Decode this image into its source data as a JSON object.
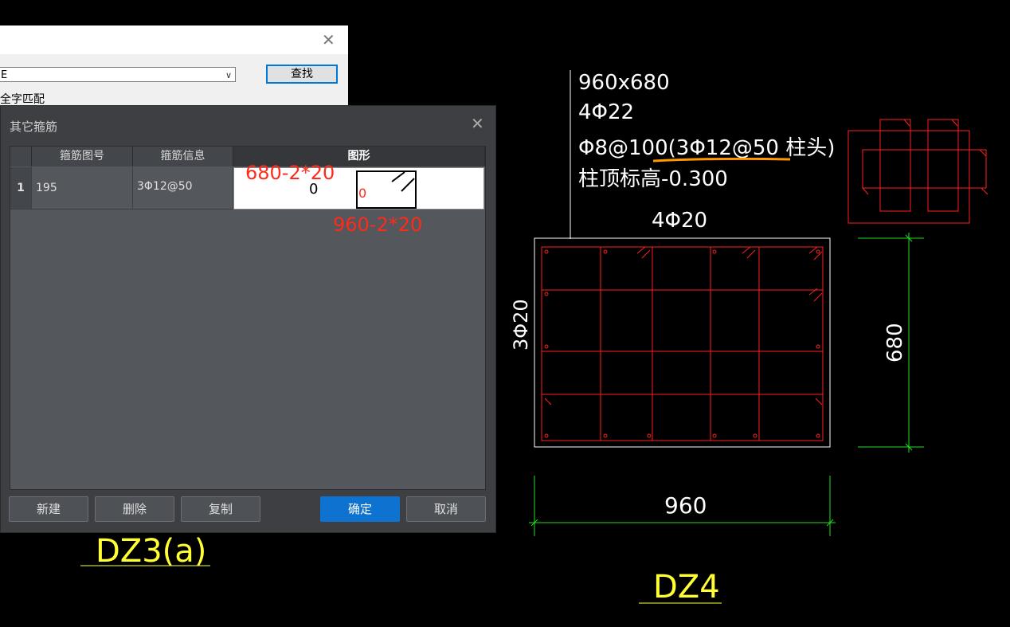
{
  "find_dialog": {
    "combo_value": "E",
    "find_label": "查找",
    "checkbox_label": "全字匹配"
  },
  "dialog": {
    "title": "其它箍筋",
    "columns": [
      "",
      "箍筋图号",
      "箍筋信息",
      "图形"
    ],
    "rows": [
      {
        "index": "1",
        "figure_no": "195",
        "info": "3Φ12@50"
      }
    ],
    "shape": {
      "top_dim": "680-2*20",
      "left_dim": "0",
      "inner_label": "0"
    },
    "buttons": {
      "new": "新建",
      "delete": "删除",
      "copy": "复制",
      "ok": "确定",
      "cancel": "取消"
    }
  },
  "overlay_dim": "960-2*20",
  "cad": {
    "dz3_label": "DZ3(a)",
    "column_text": [
      "960x680",
      "4Φ22",
      "Φ8@100(3Φ12@50  柱头)",
      "柱顶标高-0.300"
    ],
    "top_rebar": "4Φ20",
    "side_rebar": "3Φ20",
    "dim_width": "960",
    "dim_height": "680",
    "dz4_label": "DZ4"
  },
  "colors": {
    "cad_red": "#ff2020",
    "cad_white": "#ffffff",
    "cad_green": "#22dd22",
    "cad_yellow": "#ffff33",
    "underline_orange": "#ff9900",
    "primary": "#0e72d0"
  }
}
